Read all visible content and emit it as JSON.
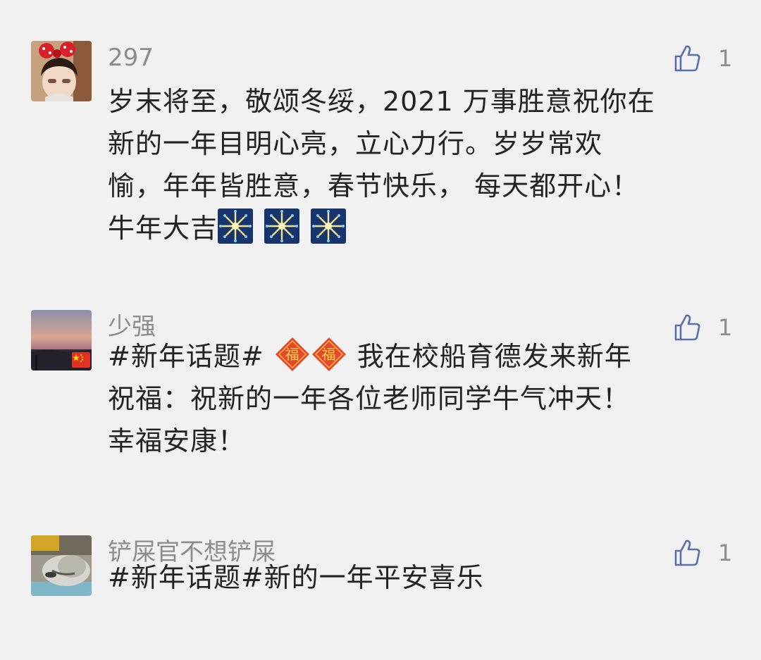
{
  "comments": [
    {
      "username": "297",
      "likes": "1",
      "lines": [
        "岁末将至，敬颂冬绥，2021 万事胜意祝你在",
        "新的一年目明心亮，立心力行。岁岁常欢",
        "愉，年年皆胜意，春节快乐， 每天都开心！",
        "牛年大吉"
      ],
      "emoji": [
        "fireworks-icon",
        "fireworks-icon",
        "fireworks-icon"
      ]
    },
    {
      "username": "少强",
      "likes": "1",
      "lines": [
        "#新年话题#",
        "我在校船育德发来新年",
        "祝福：祝新的一年各位老师同学牛气冲天！",
        "幸福安康！"
      ],
      "emoji": [
        "fu-icon",
        "fu-icon"
      ],
      "badge": "china-flag-icon"
    },
    {
      "username": "铲屎官不想铲屎",
      "likes": "1",
      "lines": [
        "#新年话题#新的一年平安喜乐"
      ]
    }
  ],
  "colors": {
    "background": "#f1f1f1",
    "username": "#8c8c8c",
    "text": "#222222",
    "like_icon": "#5a6fa8"
  }
}
